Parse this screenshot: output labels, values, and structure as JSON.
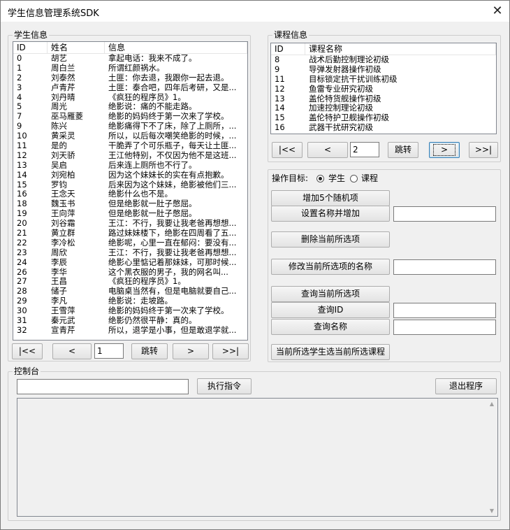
{
  "window": {
    "title": "学生信息管理系统SDK",
    "close_glyph": "✕"
  },
  "student_panel": {
    "title": "学生信息",
    "columns": [
      "ID",
      "姓名",
      "信息"
    ],
    "rows": [
      [
        "0",
        "胡艺",
        "拿起电话：我来不成了。"
      ],
      [
        "1",
        "周白兰",
        "所谓红颜祸水。"
      ],
      [
        "2",
        "刘泰然",
        "土匪：你去退，我跟你一起去退。"
      ],
      [
        "3",
        "卢青芹",
        "土匪：泰合吧，四年后考研，又是..."
      ],
      [
        "4",
        "刘丹晴",
        "《疯狂的程序员》1。"
      ],
      [
        "5",
        "周光",
        "绝影说：痛的不能走路。"
      ],
      [
        "7",
        "巫马雁菱",
        "绝影的妈妈终于第一次来了学校。"
      ],
      [
        "9",
        "陈兴",
        "绝影痛得下不了床，除了上厕所，..."
      ],
      [
        "10",
        "黄采灵",
        "所以，以后每次嘲笑绝影的时候，..."
      ],
      [
        "11",
        "是的",
        "干脆弄了个可乐瓶子，每天让土匪..."
      ],
      [
        "12",
        "刘天骄",
        "王江他特别，不仅因为他不是这班..."
      ],
      [
        "13",
        "吴启",
        "后来连上厕所也不行了。"
      ],
      [
        "14",
        "刘宛柏",
        "因为这个妹妹长的实在有点抱歉。"
      ],
      [
        "15",
        "罗钧",
        "后来因为这个妹妹，绝影被他们三..."
      ],
      [
        "16",
        "王念天",
        "绝影什么也不是。"
      ],
      [
        "18",
        "魏玉书",
        "但是绝影就一肚子憋屈。"
      ],
      [
        "19",
        "王向萍",
        "但是绝影就一肚子憋屈。"
      ],
      [
        "20",
        "刘谷霜",
        "王江：不行，我要让我老爸再想想..."
      ],
      [
        "21",
        "黄立群",
        "路过妹妹楼下，绝影在四周看了五..."
      ],
      [
        "22",
        "李冷松",
        "绝影呢，心里一直在郁闷：要没有..."
      ],
      [
        "23",
        "周欣",
        "王江：不行，我要让我老爸再想想..."
      ],
      [
        "24",
        "李辰",
        "绝影心里惦记着那妹妹，可那时候..."
      ],
      [
        "26",
        "李华",
        "这个黑衣服的男子，我的网名叫..."
      ],
      [
        "27",
        "王昌",
        "《疯狂的程序员》1。"
      ],
      [
        "28",
        "储子",
        "电脑桌当然有，但是电脑就要自己..."
      ],
      [
        "29",
        "李凡",
        "绝影说：走坡路。"
      ],
      [
        "30",
        "王雪萍",
        "绝影的妈妈终于第一次来了学校。"
      ],
      [
        "31",
        "秦元武",
        "绝影仍然很平静：真的。"
      ],
      [
        "32",
        "宣青芹",
        "所以，退学是小事，但是敢退学就..."
      ]
    ],
    "nav": {
      "first": "|<<",
      "prev": "<",
      "page": "1",
      "jump": "跳转",
      "next": ">",
      "last": ">>|"
    }
  },
  "course_panel": {
    "title": "课程信息",
    "columns": [
      "ID",
      "课程名称"
    ],
    "rows": [
      [
        "8",
        "战术后勤控制理论初级"
      ],
      [
        "9",
        "导弹发射器操作初级"
      ],
      [
        "11",
        "目标锁定抗干扰训练初级"
      ],
      [
        "12",
        "鱼雷专业研究初级"
      ],
      [
        "13",
        "盖伦特货舰操作初级"
      ],
      [
        "14",
        "加速控制理论初级"
      ],
      [
        "15",
        "盖伦特护卫舰操作初级"
      ],
      [
        "16",
        "武器干扰研究初级"
      ]
    ],
    "nav": {
      "first": "|<<",
      "prev": "<",
      "page": "2",
      "jump": "跳转",
      "next": ">",
      "last": ">>|"
    }
  },
  "ops": {
    "target_label": "操作目标:",
    "radio_student": "学生",
    "radio_course": "课程",
    "add_random": "增加5个随机项",
    "set_name_add": "设置名称并增加",
    "delete_selected": "删除当前所选项",
    "rename_selected": "修改当前所选项的名称",
    "query_selected": "查询当前所选项",
    "query_id": "查询ID",
    "query_name": "查询名称",
    "enroll": "当前所选学生选当前所选课程",
    "name_value": "",
    "rename_value": "",
    "id_value": "",
    "query_name_value": ""
  },
  "console": {
    "title": "控制台",
    "command_value": "",
    "exec": "执行指令",
    "exit": "退出程序",
    "scroll_up": "▲",
    "scroll_down": "▼"
  }
}
